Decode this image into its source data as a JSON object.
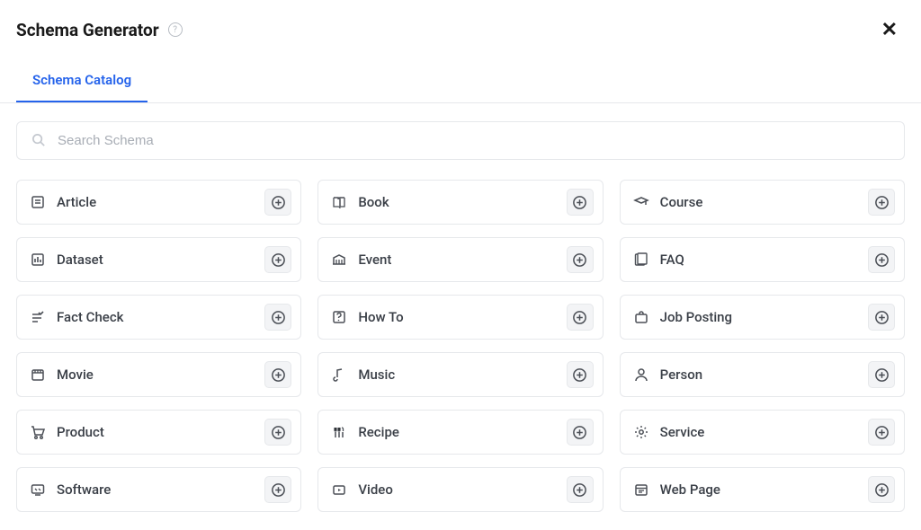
{
  "header": {
    "title": "Schema Generator"
  },
  "tabs": [
    {
      "label": "Schema Catalog"
    }
  ],
  "search": {
    "placeholder": "Search Schema"
  },
  "schemas": [
    {
      "label": "Article",
      "icon": "article"
    },
    {
      "label": "Book",
      "icon": "book"
    },
    {
      "label": "Course",
      "icon": "course"
    },
    {
      "label": "Dataset",
      "icon": "dataset"
    },
    {
      "label": "Event",
      "icon": "event"
    },
    {
      "label": "FAQ",
      "icon": "faq"
    },
    {
      "label": "Fact Check",
      "icon": "factcheck"
    },
    {
      "label": "How To",
      "icon": "howto"
    },
    {
      "label": "Job Posting",
      "icon": "job"
    },
    {
      "label": "Movie",
      "icon": "movie"
    },
    {
      "label": "Music",
      "icon": "music"
    },
    {
      "label": "Person",
      "icon": "person"
    },
    {
      "label": "Product",
      "icon": "product"
    },
    {
      "label": "Recipe",
      "icon": "recipe"
    },
    {
      "label": "Service",
      "icon": "service"
    },
    {
      "label": "Software",
      "icon": "software"
    },
    {
      "label": "Video",
      "icon": "video"
    },
    {
      "label": "Web Page",
      "icon": "webpage"
    }
  ]
}
